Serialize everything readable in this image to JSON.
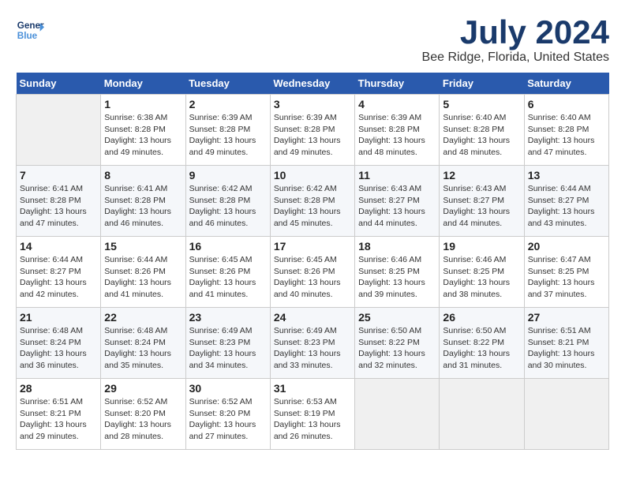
{
  "header": {
    "logo_line1": "General",
    "logo_line2": "Blue",
    "month_year": "July 2024",
    "location": "Bee Ridge, Florida, United States"
  },
  "days_of_week": [
    "Sunday",
    "Monday",
    "Tuesday",
    "Wednesday",
    "Thursday",
    "Friday",
    "Saturday"
  ],
  "weeks": [
    [
      {
        "day": "",
        "info": ""
      },
      {
        "day": "1",
        "info": "Sunrise: 6:38 AM\nSunset: 8:28 PM\nDaylight: 13 hours\nand 49 minutes."
      },
      {
        "day": "2",
        "info": "Sunrise: 6:39 AM\nSunset: 8:28 PM\nDaylight: 13 hours\nand 49 minutes."
      },
      {
        "day": "3",
        "info": "Sunrise: 6:39 AM\nSunset: 8:28 PM\nDaylight: 13 hours\nand 49 minutes."
      },
      {
        "day": "4",
        "info": "Sunrise: 6:39 AM\nSunset: 8:28 PM\nDaylight: 13 hours\nand 48 minutes."
      },
      {
        "day": "5",
        "info": "Sunrise: 6:40 AM\nSunset: 8:28 PM\nDaylight: 13 hours\nand 48 minutes."
      },
      {
        "day": "6",
        "info": "Sunrise: 6:40 AM\nSunset: 8:28 PM\nDaylight: 13 hours\nand 47 minutes."
      }
    ],
    [
      {
        "day": "7",
        "info": "Sunrise: 6:41 AM\nSunset: 8:28 PM\nDaylight: 13 hours\nand 47 minutes."
      },
      {
        "day": "8",
        "info": "Sunrise: 6:41 AM\nSunset: 8:28 PM\nDaylight: 13 hours\nand 46 minutes."
      },
      {
        "day": "9",
        "info": "Sunrise: 6:42 AM\nSunset: 8:28 PM\nDaylight: 13 hours\nand 46 minutes."
      },
      {
        "day": "10",
        "info": "Sunrise: 6:42 AM\nSunset: 8:28 PM\nDaylight: 13 hours\nand 45 minutes."
      },
      {
        "day": "11",
        "info": "Sunrise: 6:43 AM\nSunset: 8:27 PM\nDaylight: 13 hours\nand 44 minutes."
      },
      {
        "day": "12",
        "info": "Sunrise: 6:43 AM\nSunset: 8:27 PM\nDaylight: 13 hours\nand 44 minutes."
      },
      {
        "day": "13",
        "info": "Sunrise: 6:44 AM\nSunset: 8:27 PM\nDaylight: 13 hours\nand 43 minutes."
      }
    ],
    [
      {
        "day": "14",
        "info": "Sunrise: 6:44 AM\nSunset: 8:27 PM\nDaylight: 13 hours\nand 42 minutes."
      },
      {
        "day": "15",
        "info": "Sunrise: 6:44 AM\nSunset: 8:26 PM\nDaylight: 13 hours\nand 41 minutes."
      },
      {
        "day": "16",
        "info": "Sunrise: 6:45 AM\nSunset: 8:26 PM\nDaylight: 13 hours\nand 41 minutes."
      },
      {
        "day": "17",
        "info": "Sunrise: 6:45 AM\nSunset: 8:26 PM\nDaylight: 13 hours\nand 40 minutes."
      },
      {
        "day": "18",
        "info": "Sunrise: 6:46 AM\nSunset: 8:25 PM\nDaylight: 13 hours\nand 39 minutes."
      },
      {
        "day": "19",
        "info": "Sunrise: 6:46 AM\nSunset: 8:25 PM\nDaylight: 13 hours\nand 38 minutes."
      },
      {
        "day": "20",
        "info": "Sunrise: 6:47 AM\nSunset: 8:25 PM\nDaylight: 13 hours\nand 37 minutes."
      }
    ],
    [
      {
        "day": "21",
        "info": "Sunrise: 6:48 AM\nSunset: 8:24 PM\nDaylight: 13 hours\nand 36 minutes."
      },
      {
        "day": "22",
        "info": "Sunrise: 6:48 AM\nSunset: 8:24 PM\nDaylight: 13 hours\nand 35 minutes."
      },
      {
        "day": "23",
        "info": "Sunrise: 6:49 AM\nSunset: 8:23 PM\nDaylight: 13 hours\nand 34 minutes."
      },
      {
        "day": "24",
        "info": "Sunrise: 6:49 AM\nSunset: 8:23 PM\nDaylight: 13 hours\nand 33 minutes."
      },
      {
        "day": "25",
        "info": "Sunrise: 6:50 AM\nSunset: 8:22 PM\nDaylight: 13 hours\nand 32 minutes."
      },
      {
        "day": "26",
        "info": "Sunrise: 6:50 AM\nSunset: 8:22 PM\nDaylight: 13 hours\nand 31 minutes."
      },
      {
        "day": "27",
        "info": "Sunrise: 6:51 AM\nSunset: 8:21 PM\nDaylight: 13 hours\nand 30 minutes."
      }
    ],
    [
      {
        "day": "28",
        "info": "Sunrise: 6:51 AM\nSunset: 8:21 PM\nDaylight: 13 hours\nand 29 minutes."
      },
      {
        "day": "29",
        "info": "Sunrise: 6:52 AM\nSunset: 8:20 PM\nDaylight: 13 hours\nand 28 minutes."
      },
      {
        "day": "30",
        "info": "Sunrise: 6:52 AM\nSunset: 8:20 PM\nDaylight: 13 hours\nand 27 minutes."
      },
      {
        "day": "31",
        "info": "Sunrise: 6:53 AM\nSunset: 8:19 PM\nDaylight: 13 hours\nand 26 minutes."
      },
      {
        "day": "",
        "info": ""
      },
      {
        "day": "",
        "info": ""
      },
      {
        "day": "",
        "info": ""
      }
    ]
  ]
}
